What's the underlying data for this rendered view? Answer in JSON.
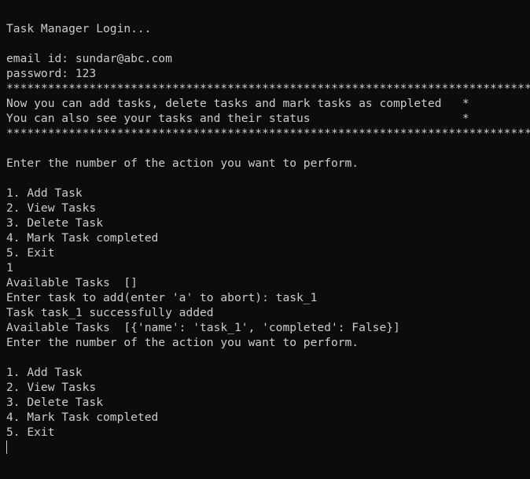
{
  "terminal": {
    "colors": {
      "background": "#0c0c0c",
      "foreground": "#cccccc"
    },
    "lines": [
      "Task Manager Login...",
      "",
      "email id: sundar@abc.com",
      "password: 123",
      "*****************************************************************************",
      "Now you can add tasks, delete tasks and mark tasks as completed   *",
      "You can also see your tasks and their status                      *",
      "******************************************************************************",
      "",
      "Enter the number of the action you want to perform.",
      "",
      "1. Add Task",
      "2. View Tasks",
      "3. Delete Task",
      "4. Mark Task completed",
      "5. Exit",
      "1",
      "Available Tasks  []",
      "Enter task to add(enter 'a' to abort): task_1",
      "Task task_1 successfully added",
      "Available Tasks  [{'name': 'task_1', 'completed': False}]",
      "Enter the number of the action you want to perform.",
      "",
      "1. Add Task",
      "2. View Tasks",
      "3. Delete Task",
      "4. Mark Task completed",
      "5. Exit",
      ""
    ]
  }
}
